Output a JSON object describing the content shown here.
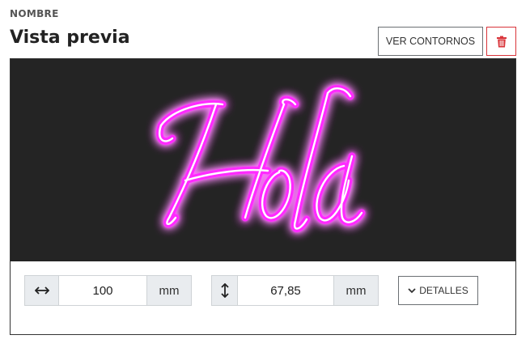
{
  "field": {
    "label": "NOMBRE"
  },
  "header": {
    "title": "Vista previa",
    "outline_button_label": "VER CONTORNOS",
    "delete_icon": "trash-icon",
    "delete_color": "#d9343a"
  },
  "preview": {
    "text": "Hola",
    "background": "#242424",
    "neon_color": "#ff2bff"
  },
  "dimensions": {
    "width": {
      "icon": "horizontal-arrows-icon",
      "value": "100",
      "unit": "mm"
    },
    "height": {
      "icon": "vertical-arrows-icon",
      "value": "67,85",
      "unit": "mm"
    }
  },
  "details": {
    "icon": "chevron-down-icon",
    "label": "DETALLES"
  }
}
